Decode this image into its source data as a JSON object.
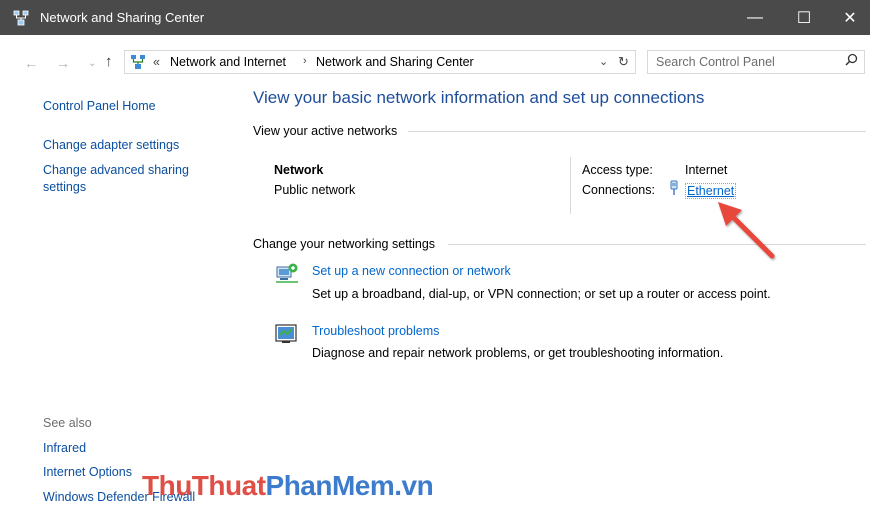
{
  "window": {
    "title": "Network and Sharing Center",
    "controls": {
      "minimize": "—",
      "maximize": "☐",
      "close": "✕"
    }
  },
  "nav": {
    "back": "←",
    "forward": "→",
    "recent": "⌄",
    "up": "↑",
    "breadcrumb": {
      "overflow": "«",
      "items": [
        "Network and Internet",
        "Network and Sharing Center"
      ],
      "separator": "›"
    },
    "dropdown": "⌄",
    "refresh": "↻",
    "search": {
      "placeholder": "Search Control Panel",
      "value": ""
    }
  },
  "sidebar": {
    "home": "Control Panel Home",
    "links": [
      "Change adapter settings",
      "Change advanced sharing",
      "settings"
    ],
    "see_also": "See also",
    "see_also_links": [
      "Infrared",
      "Internet Options",
      "Windows Defender Firewall"
    ]
  },
  "main": {
    "heading": "View your basic network information and set up connections",
    "active_networks_label": "View your active networks",
    "network": {
      "name": "Network",
      "type": "Public network",
      "access_type_label": "Access type:",
      "access_type_value": "Internet",
      "connections_label": "Connections:",
      "connection_link": "Ethernet"
    },
    "settings_label": "Change your networking settings",
    "tasks": [
      {
        "title": "Set up a new connection or network",
        "description": "Set up a broadband, dial-up, or VPN connection; or set up a router or access point."
      },
      {
        "title": "Troubleshoot problems",
        "description": "Diagnose and repair network problems, or get troubleshooting information."
      }
    ]
  },
  "watermark": {
    "part1": "ThuThuat",
    "part2": "PhanMem.vn"
  },
  "icons": {
    "app": "network-sharing-icon",
    "connection": "ethernet-plug-icon",
    "task1": "new-connection-icon",
    "task2": "troubleshoot-icon"
  },
  "colors": {
    "titlebar": "#4a4a4a",
    "link": "#0066cc",
    "heading": "#1e4e9a",
    "arrow": "#e8473b"
  }
}
